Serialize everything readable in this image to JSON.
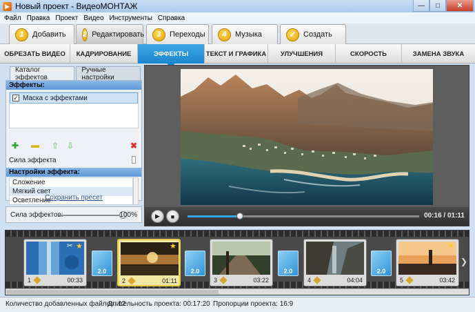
{
  "window": {
    "title": "Новый проект - ВидеоМОНТАЖ",
    "minimize": "—",
    "maximize": "□",
    "close": "✕"
  },
  "menu": [
    "Файл",
    "Правка",
    "Проект",
    "Видео",
    "Инструменты",
    "Справка"
  ],
  "steps": [
    {
      "num": "1",
      "label": "Добавить"
    },
    {
      "num": "2",
      "label": "Редактировать",
      "active": true
    },
    {
      "num": "3",
      "label": "Переходы"
    },
    {
      "num": "4",
      "label": "Музыка"
    },
    {
      "num": "✓",
      "label": "Создать"
    }
  ],
  "categories": [
    "ОБРЕЗАТЬ ВИДЕО",
    "КАДРИРОВАНИЕ",
    "ЭФФЕКТЫ",
    "ТЕКСТ И ГРАФИКА",
    "УЛУЧШЕНИЯ",
    "СКОРОСТЬ",
    "ЗАМЕНА ЗВУКА"
  ],
  "active_category": "ЭФФЕКТЫ",
  "left_panel": {
    "tabs": [
      "Каталог эффектов",
      "Ручные настройки"
    ],
    "effects_header": "Эффекты:",
    "effects": [
      {
        "label": "Маска с эффектами",
        "checked": true
      }
    ],
    "strength_label": "Сила эффекта",
    "settings_header": "Настройки эффекта:",
    "settings": [
      "Сложение",
      "Мягкий свет",
      "Осветление"
    ],
    "selected_setting": "Мягкий свет",
    "save_preset": "Сохранить пресет",
    "effects_strength_label": "Сила эффектов:",
    "effects_strength_value": "100%",
    "effects_strength_fraction": 0.95
  },
  "player": {
    "time": "00:16 / 01:11",
    "progress": 0.225,
    "play": "▶",
    "stop": "■"
  },
  "timeline": {
    "clips": [
      {
        "num": "1",
        "time": "00:33",
        "star": true,
        "scissors": true
      },
      {
        "num": "2",
        "time": "01:11",
        "star": true,
        "selected": true
      },
      {
        "num": "3",
        "time": "03:22"
      },
      {
        "num": "4",
        "time": "04:04"
      },
      {
        "num": "5",
        "time": "03:42",
        "star": true
      }
    ],
    "transitions": [
      "2.0",
      "2.0",
      "2.0",
      "2.0"
    ],
    "scroll_arrow": "❯"
  },
  "status": {
    "files": "Количество добавленных файлов: 12",
    "duration": "Длительность проекта: 00:17:20",
    "ratio": "Пропорции проекта: 16:9"
  },
  "colors": {
    "accent": "#1b86cf",
    "selected_clip": "#e7cc44",
    "seek_fill": "#38a8ec"
  }
}
